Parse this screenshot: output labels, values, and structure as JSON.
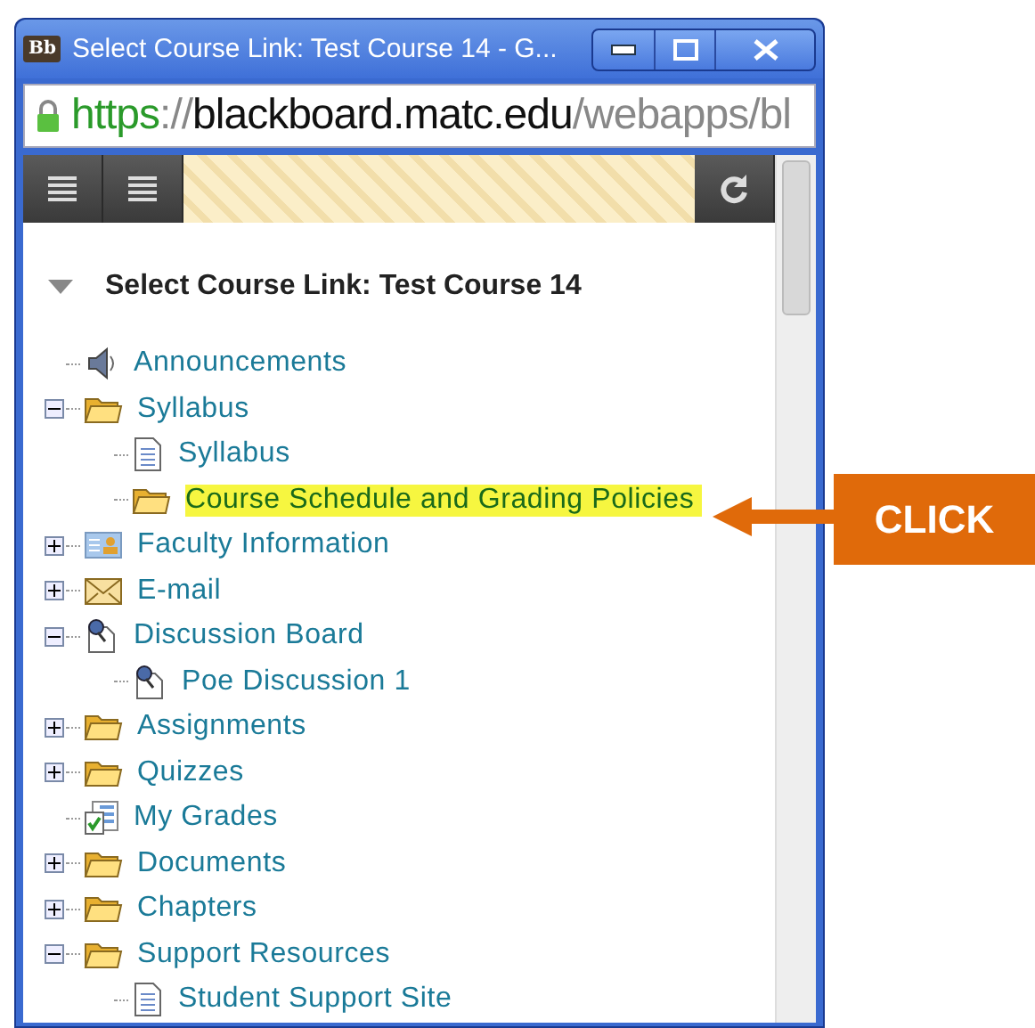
{
  "window": {
    "app_logo": "Bb",
    "title": "Select Course Link: Test Course 14 - G..."
  },
  "address_bar": {
    "scheme": "https",
    "separator": "://",
    "host": "blackboard.matc.edu",
    "path": "/webapps/bl"
  },
  "panel": {
    "heading": "Select Course Link: Test Course 14",
    "expanded": true
  },
  "tree": [
    {
      "label": "Announcements",
      "kind": "announcement",
      "selected": false
    },
    {
      "label": "Syllabus",
      "kind": "folder",
      "expanded": true,
      "selected": false,
      "children": [
        {
          "label": "Syllabus",
          "kind": "page",
          "selected": false
        },
        {
          "label": "Course Schedule and Grading Policies",
          "kind": "folder",
          "selected": true
        }
      ]
    },
    {
      "label": "Faculty Information",
      "kind": "contact",
      "expanded": false,
      "selected": false
    },
    {
      "label": "E-mail",
      "kind": "mail",
      "expanded": false,
      "selected": false
    },
    {
      "label": "Discussion Board",
      "kind": "discussion",
      "expanded": true,
      "selected": false,
      "children": [
        {
          "label": "Poe Discussion 1",
          "kind": "discussion",
          "selected": false
        }
      ]
    },
    {
      "label": "Assignments",
      "kind": "folder",
      "expanded": false,
      "selected": false
    },
    {
      "label": "Quizzes",
      "kind": "folder",
      "expanded": false,
      "selected": false
    },
    {
      "label": "My Grades",
      "kind": "grades",
      "selected": false
    },
    {
      "label": "Documents",
      "kind": "folder",
      "expanded": false,
      "selected": false
    },
    {
      "label": "Chapters",
      "kind": "folder",
      "expanded": false,
      "selected": false
    },
    {
      "label": "Support Resources",
      "kind": "folder",
      "expanded": true,
      "selected": false,
      "children": [
        {
          "label": "Student Support Site",
          "kind": "page",
          "selected": false
        }
      ]
    }
  ],
  "callout": {
    "label": "CLICK"
  }
}
